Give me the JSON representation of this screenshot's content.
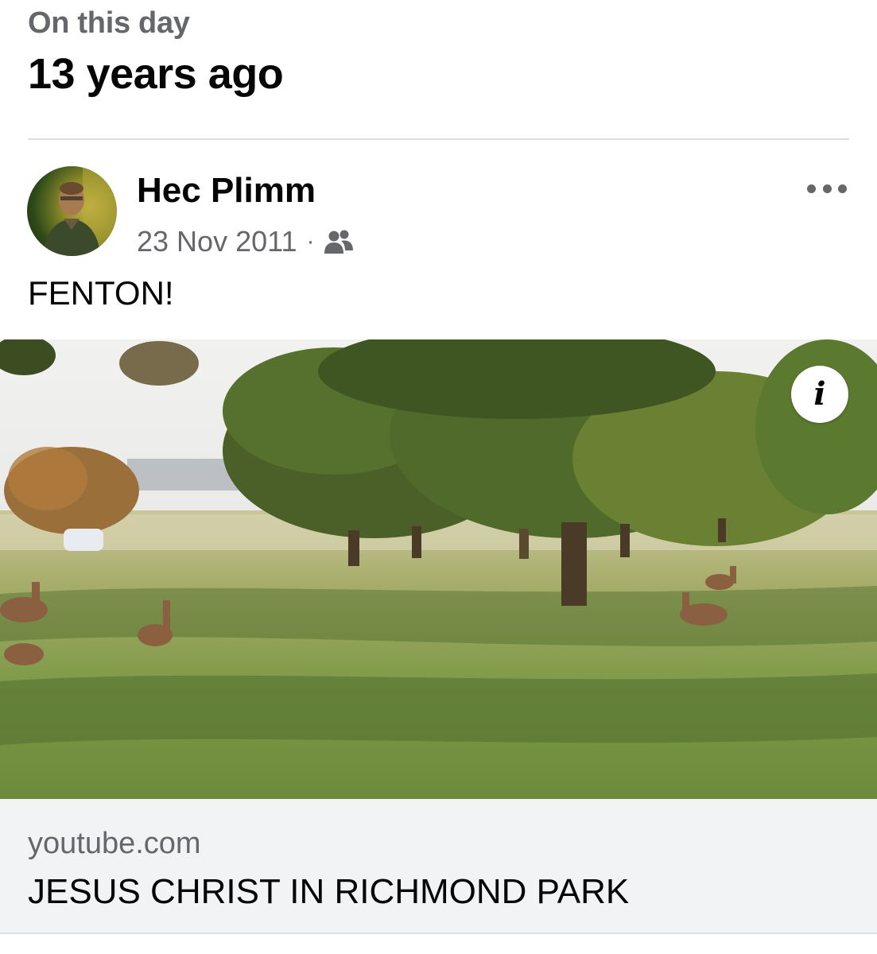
{
  "memory": {
    "subtitle": "On this day",
    "title": "13 years ago"
  },
  "post": {
    "author": "Hec Plimm",
    "date": "23 Nov 2011",
    "separator": "·",
    "audience_icon": "friends-icon",
    "more_icon": "more-options-icon",
    "text": "FENTON!"
  },
  "link": {
    "info_icon": "info-icon",
    "info_glyph": "i",
    "domain": "youtube.com",
    "title": "JESUS CHRIST IN RICHMOND PARK"
  },
  "colors": {
    "primary_text": "#050505",
    "secondary_text": "#65676b",
    "footer_bg": "#f2f3f5",
    "divider": "#dcdde1"
  }
}
